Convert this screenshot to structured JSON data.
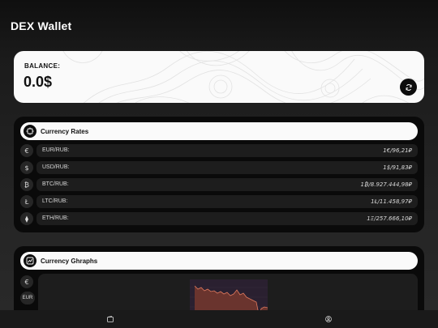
{
  "app": {
    "title": "DEX Wallet"
  },
  "balance": {
    "label": "BALANCE:",
    "value": "0.0$",
    "refresh_icon": "refresh-icon"
  },
  "rates": {
    "title": "Currency Rates",
    "icon": "currency-rates-icon",
    "rows": [
      {
        "icon": "euro-icon",
        "symbol": "€",
        "pair": "EUR/RUB:",
        "rate": "1€/96,21₽"
      },
      {
        "icon": "dollar-icon",
        "symbol": "$",
        "pair": "USD/RUB:",
        "rate": "1$/91,83₽"
      },
      {
        "icon": "bitcoin-icon",
        "symbol": "₿",
        "pair": "BTC/RUB:",
        "rate": "1₿/8.927.444,98₽"
      },
      {
        "icon": "litecoin-icon",
        "symbol": "Ł",
        "pair": "LTC/RUB:",
        "rate": "1Ł/11.458,97₽"
      },
      {
        "icon": "ethereum-icon",
        "symbol": "⧫",
        "pair": "ETH/RUB:",
        "rate": "1Ξ/257.666,10₽"
      }
    ]
  },
  "graphs": {
    "title": "Currency Ghraphs",
    "icon": "chart-icon",
    "selected_symbol": "€",
    "selected_code": "EUR",
    "chart_colors": {
      "line": "#e07a5f",
      "fill": "#7a3a2e",
      "bg": "#2a2030"
    }
  },
  "nav": {
    "items": [
      "wallet-icon",
      "user-icon"
    ]
  }
}
